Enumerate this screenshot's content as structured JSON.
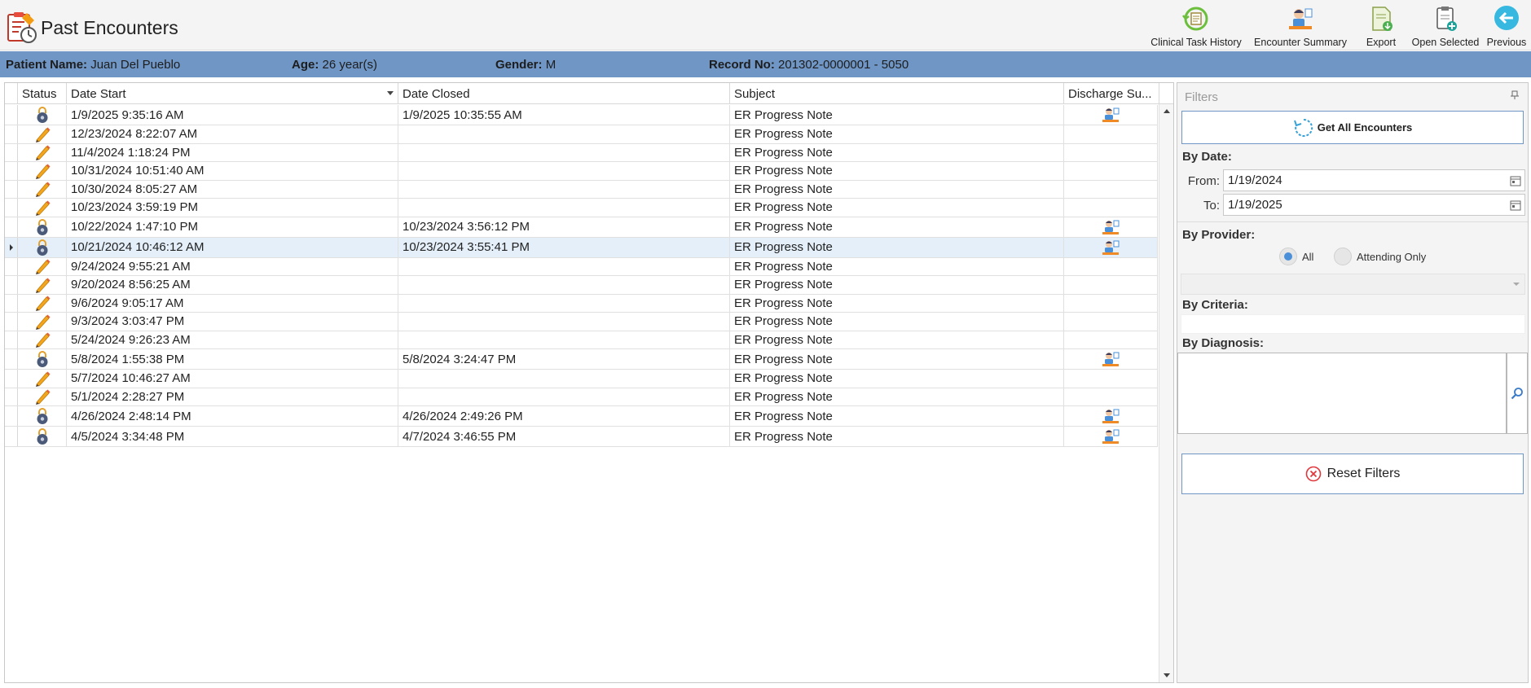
{
  "header": {
    "title": "Past Encounters",
    "toolbar": [
      {
        "label": "Clinical Task History",
        "icon": "clinical-task-history-icon"
      },
      {
        "label": "Encounter Summary",
        "icon": "encounter-summary-icon"
      },
      {
        "label": "Export",
        "icon": "export-icon"
      },
      {
        "label": "Open Selected",
        "icon": "open-selected-icon"
      },
      {
        "label": "Previous",
        "icon": "previous-icon"
      }
    ]
  },
  "patient": {
    "name_label": "Patient Name:",
    "name": "Juan Del Pueblo",
    "age_label": "Age:",
    "age": "26 year(s)",
    "gender_label": "Gender:",
    "gender": "M",
    "record_label": "Record No:",
    "record": "201302-0000001 - 5050"
  },
  "grid": {
    "columns": [
      "Status",
      "Date Start",
      "Date Closed",
      "Subject",
      "Discharge Su..."
    ],
    "sorted_column": "Date Start",
    "selected_row": 7,
    "rows": [
      {
        "status": "locked",
        "date_start": "1/9/2025 9:35:16 AM",
        "date_closed": "1/9/2025 10:35:55 AM",
        "subject": "ER Progress Note",
        "discharge": true
      },
      {
        "status": "edit",
        "date_start": "12/23/2024 8:22:07 AM",
        "date_closed": "",
        "subject": "ER Progress Note",
        "discharge": false
      },
      {
        "status": "edit",
        "date_start": "11/4/2024 1:18:24 PM",
        "date_closed": "",
        "subject": "ER Progress Note",
        "discharge": false
      },
      {
        "status": "edit",
        "date_start": "10/31/2024 10:51:40 AM",
        "date_closed": "",
        "subject": "ER Progress Note",
        "discharge": false
      },
      {
        "status": "edit",
        "date_start": "10/30/2024 8:05:27 AM",
        "date_closed": "",
        "subject": "ER Progress Note",
        "discharge": false
      },
      {
        "status": "edit",
        "date_start": "10/23/2024 3:59:19 PM",
        "date_closed": "",
        "subject": "ER Progress Note",
        "discharge": false
      },
      {
        "status": "locked",
        "date_start": "10/22/2024 1:47:10 PM",
        "date_closed": "10/23/2024 3:56:12 PM",
        "subject": "ER Progress Note",
        "discharge": true
      },
      {
        "status": "locked",
        "date_start": "10/21/2024 10:46:12 AM",
        "date_closed": "10/23/2024 3:55:41 PM",
        "subject": "ER Progress Note",
        "discharge": true
      },
      {
        "status": "edit",
        "date_start": "9/24/2024 9:55:21 AM",
        "date_closed": "",
        "subject": "ER Progress Note",
        "discharge": false
      },
      {
        "status": "edit",
        "date_start": "9/20/2024 8:56:25 AM",
        "date_closed": "",
        "subject": "ER Progress Note",
        "discharge": false
      },
      {
        "status": "edit",
        "date_start": "9/6/2024 9:05:17 AM",
        "date_closed": "",
        "subject": "ER Progress Note",
        "discharge": false
      },
      {
        "status": "edit",
        "date_start": "9/3/2024 3:03:47 PM",
        "date_closed": "",
        "subject": "ER Progress Note",
        "discharge": false
      },
      {
        "status": "edit",
        "date_start": "5/24/2024 9:26:23 AM",
        "date_closed": "",
        "subject": "ER Progress Note",
        "discharge": false
      },
      {
        "status": "locked",
        "date_start": "5/8/2024 1:55:38 PM",
        "date_closed": "5/8/2024 3:24:47 PM",
        "subject": "ER Progress Note",
        "discharge": true
      },
      {
        "status": "edit",
        "date_start": "5/7/2024 10:46:27 AM",
        "date_closed": "",
        "subject": "ER Progress Note",
        "discharge": false
      },
      {
        "status": "edit",
        "date_start": "5/1/2024 2:28:27 PM",
        "date_closed": "",
        "subject": "ER Progress Note",
        "discharge": false
      },
      {
        "status": "locked",
        "date_start": "4/26/2024 2:48:14 PM",
        "date_closed": "4/26/2024 2:49:26 PM",
        "subject": "ER Progress Note",
        "discharge": true
      },
      {
        "status": "locked",
        "date_start": "4/5/2024 3:34:48 PM",
        "date_closed": "4/7/2024 3:46:55 PM",
        "subject": "ER Progress Note",
        "discharge": true
      }
    ]
  },
  "filters": {
    "title": "Filters",
    "get_all_label": "Get All Encounters",
    "by_date_label": "By Date:",
    "from_label": "From:",
    "from_value": "1/19/2024",
    "to_label": "To:",
    "to_value": "1/19/2025",
    "by_provider_label": "By Provider:",
    "provider_options": [
      "All",
      "Attending Only"
    ],
    "provider_selected": "All",
    "by_criteria_label": "By Criteria:",
    "by_diagnosis_label": "By Diagnosis:",
    "reset_label": "Reset Filters"
  },
  "colors": {
    "banner": "#6f96c5",
    "accent_border": "#6f96c5",
    "selected_row": "#e4eff9",
    "radio_on": "#4a8fd8",
    "reset_icon": "#e0383e",
    "pencil": "#f2a61e"
  }
}
